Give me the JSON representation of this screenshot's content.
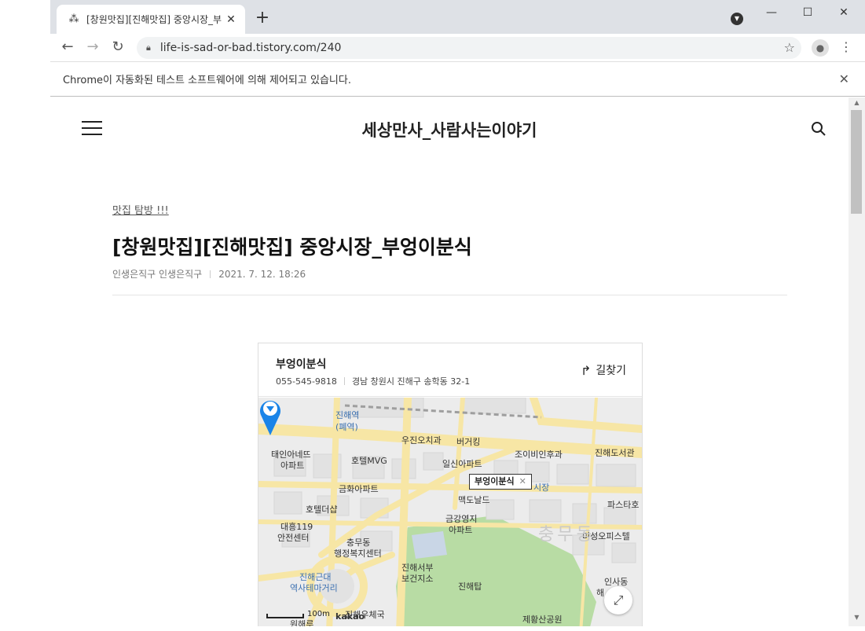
{
  "browser": {
    "tab_title": "[창원맛집][진해맛집] 중앙시장_부",
    "tab_close": "✕",
    "new_tab": "+",
    "url": "life-is-sad-or-bad.tistory.com/240",
    "infobar_message": "Chrome이 자동화된 테스트 소프트웨어에 의해 제어되고 있습니다.",
    "infobar_close": "✕"
  },
  "site": {
    "title": "세상만사_사람사는이야기"
  },
  "post": {
    "category": "맛집 탐방 !!!",
    "title": "[창원맛집][진해맛집] 중앙시장_부엉이분식",
    "author": "인생은직구 인생은직구",
    "datetime": "2021. 7. 12. 18:26"
  },
  "map": {
    "place_name": "부엉이분식",
    "phone": "055-545-9818",
    "address": "경남 창원시 진해구 송학동 32-1",
    "directions_label": "길찾기",
    "pin_label": "부엉이분식",
    "scale_label": "100m",
    "brand": "kakao",
    "labels": [
      {
        "text": "진해역",
        "cls": "blue"
      },
      {
        "text": "(폐역)",
        "cls": "blue"
      },
      {
        "text": "우진오치과",
        "cls": ""
      },
      {
        "text": "버거킹",
        "cls": ""
      },
      {
        "text": "조이비인후과",
        "cls": ""
      },
      {
        "text": "진해도서관",
        "cls": ""
      },
      {
        "text": "태인아네뜨",
        "cls": ""
      },
      {
        "text": "아파트",
        "cls": ""
      },
      {
        "text": "호텔MVG",
        "cls": ""
      },
      {
        "text": "일신아파트",
        "cls": ""
      },
      {
        "text": "금화아파트",
        "cls": ""
      },
      {
        "text": "맥도날드",
        "cls": ""
      },
      {
        "text": "파스타호",
        "cls": ""
      },
      {
        "text": "호텔더샵",
        "cls": ""
      },
      {
        "text": "금강영지",
        "cls": ""
      },
      {
        "text": "아파트",
        "cls": ""
      },
      {
        "text": "대흥119",
        "cls": ""
      },
      {
        "text": "안전센터",
        "cls": ""
      },
      {
        "text": "충무동",
        "cls": ""
      },
      {
        "text": "행정복지센터",
        "cls": ""
      },
      {
        "text": "미성오피스텔",
        "cls": ""
      },
      {
        "text": "진해서부",
        "cls": ""
      },
      {
        "text": "보건지소",
        "cls": ""
      },
      {
        "text": "진해근대",
        "cls": "blue"
      },
      {
        "text": "역사테마거리",
        "cls": "blue"
      },
      {
        "text": "진해탑",
        "cls": ""
      },
      {
        "text": "인사동",
        "cls": ""
      },
      {
        "text": "해",
        "cls": ""
      },
      {
        "text": "진해우체국",
        "cls": ""
      },
      {
        "text": "제황산공원",
        "cls": ""
      },
      {
        "text": "원해루",
        "cls": ""
      },
      {
        "text": "충무동",
        "cls": "big"
      },
      {
        "text": "시장",
        "cls": "blue"
      }
    ]
  },
  "colors": {
    "accent_pin": "#1a84e8",
    "road": "#f7e6a5",
    "park": "#b8dca4"
  }
}
